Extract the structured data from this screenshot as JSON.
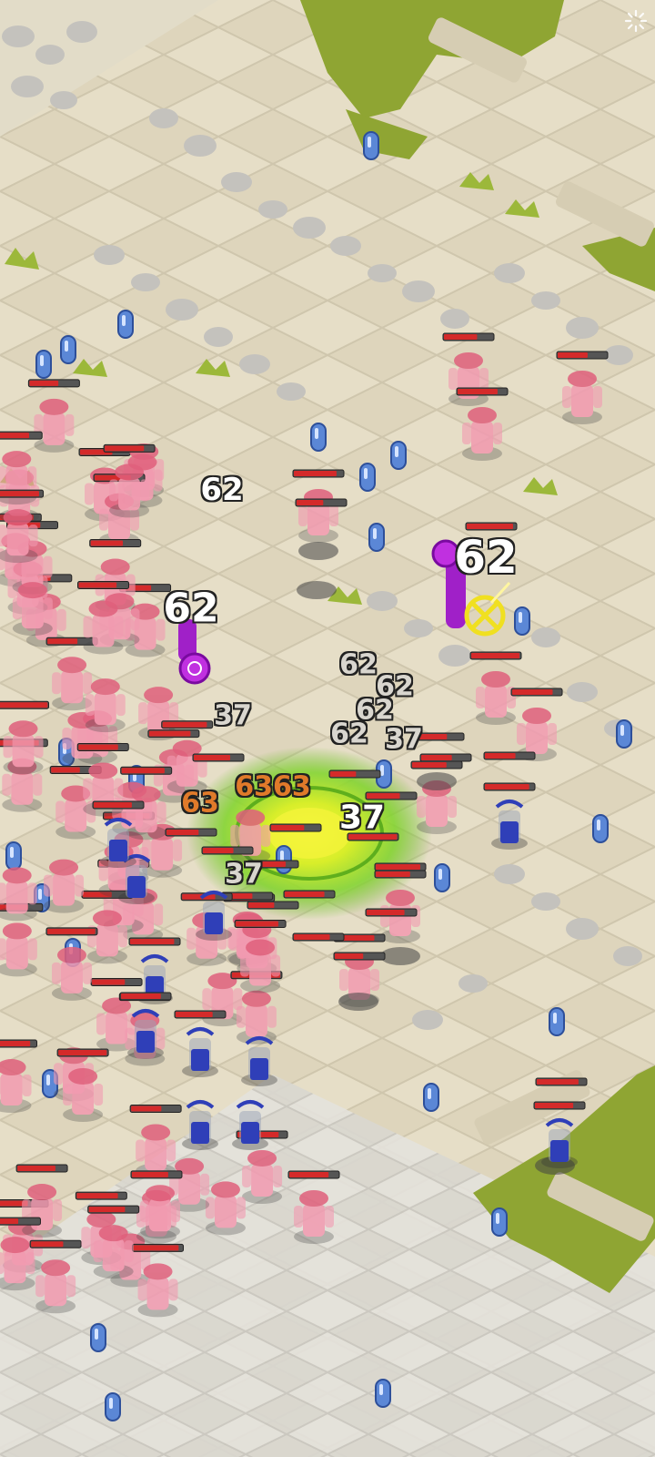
{
  "colors": {
    "ground": "#e8e1cf",
    "tile": "#ddd4bc",
    "tile_line": "#cfc6ad",
    "stone": "#c4c2bd",
    "grass": "#8fa533",
    "enemy": "#f29ab0",
    "enemy_dark": "#e0607c",
    "ally": "#2f3fb8",
    "hp_red": "#d42a2a",
    "hp_bg": "#555555",
    "aoe_green": "#7fd42a",
    "aoe_yellow": "#f0f02a",
    "mage_purple": "#a020c8",
    "gem_blue": "#5b87d6"
  },
  "icons": {
    "loading": "loading-spinner-icon",
    "target": "target-reticle-icon",
    "gem": "mana-gem-icon"
  },
  "damage_numbers": [
    {
      "text": "62",
      "style": "big"
    },
    {
      "text": "62",
      "style": "big"
    },
    {
      "text": "62",
      "style": "mid"
    },
    {
      "text": "62",
      "style": "sm"
    },
    {
      "text": "62",
      "style": "sm"
    },
    {
      "text": "62",
      "style": "sm"
    },
    {
      "text": "62",
      "style": "sm"
    },
    {
      "text": "37",
      "style": "sm"
    },
    {
      "text": "37",
      "style": "sm"
    },
    {
      "text": "37",
      "style": "mid"
    },
    {
      "text": "37",
      "style": "sm"
    },
    {
      "text": "63",
      "style": "orange"
    },
    {
      "text": "6363",
      "style": "orange"
    }
  ]
}
